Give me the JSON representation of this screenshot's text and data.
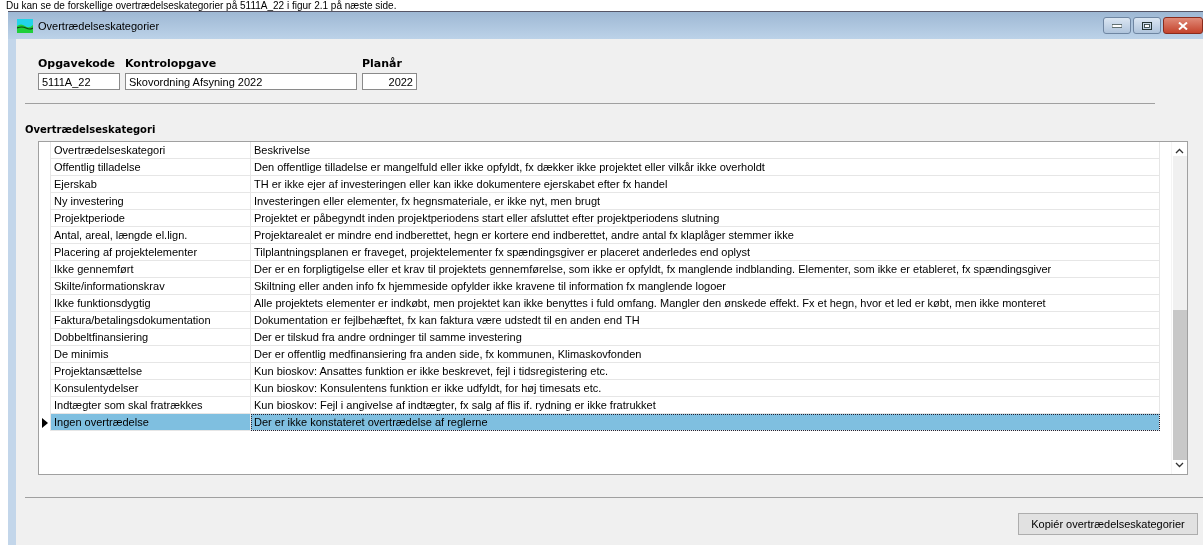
{
  "doc_text": "Du kan se de forskellige overtrædelseskategorier på 5111A_22 i figur 2.1 på næste side.",
  "window": {
    "title": "Overtrædelseskategorier"
  },
  "fields": [
    {
      "kind": "code",
      "label": "Opgavekode",
      "value": "5111A_22"
    },
    {
      "kind": "task",
      "label": "Kontrolopgave",
      "value": "Skovordning Afsyning 2022"
    },
    {
      "kind": "year",
      "label": "Planår",
      "value": "2022"
    }
  ],
  "section_label": "Overtrædelseskategori",
  "table": {
    "columns": [
      "Overtrædelseskategori",
      "Beskrivelse"
    ],
    "rows": [
      {
        "category": "Offentlig tilladelse",
        "description": "Den offentlige tilladelse er mangelfuld eller ikke opfyldt, fx dækker ikke projektet eller vilkår ikke overholdt",
        "selected": false
      },
      {
        "category": "Ejerskab",
        "description": "TH er ikke ejer af investeringen eller kan ikke dokumentere ejerskabet efter fx handel",
        "selected": false
      },
      {
        "category": "Ny investering",
        "description": "Investeringen eller elementer, fx hegnsmateriale, er ikke nyt, men brugt",
        "selected": false
      },
      {
        "category": "Projektperiode",
        "description": "Projektet er påbegyndt inden projektperiodens start eller afsluttet efter projektperiodens slutning",
        "selected": false
      },
      {
        "category": "Antal, areal, længde el.lign.",
        "description": "Projektarealet er mindre end indberettet, hegn er kortere end indberettet, andre antal fx klaplåger stemmer ikke",
        "selected": false
      },
      {
        "category": "Placering af projektelementer",
        "description": "Tilplantningsplanen er fraveget, projektelementer fx spændingsgiver er placeret anderledes end oplyst",
        "selected": false
      },
      {
        "category": "Ikke gennemført",
        "description": "Der er en forpligtigelse eller et krav til projektets gennemførelse, som ikke er opfyldt, fx manglende indblanding. Elementer, som ikke er etableret, fx spændingsgiver",
        "selected": false
      },
      {
        "category": "Skilte/informationskrav",
        "description": "Skiltning eller anden info fx hjemmeside opfylder ikke kravene til information fx manglende logoer",
        "selected": false
      },
      {
        "category": "Ikke funktionsdygtig",
        "description": "Alle projektets elementer er indkøbt, men projektet kan ikke benyttes i fuld omfang. Mangler den ønskede effekt. Fx et hegn, hvor et led er købt, men ikke monteret",
        "selected": false
      },
      {
        "category": "Faktura/betalingsdokumentation",
        "description": "Dokumentation er fejlbehæftet, fx kan faktura være udstedt til en anden end TH",
        "selected": false
      },
      {
        "category": "Dobbeltfinansiering",
        "description": "Der er tilskud fra andre ordninger til samme investering",
        "selected": false
      },
      {
        "category": "De minimis",
        "description": "Der er offentlig medfinansiering fra anden side, fx kommunen, Klimaskovfonden",
        "selected": false
      },
      {
        "category": "Projektansættelse",
        "description": "Kun bioskov: Ansattes funktion er ikke beskrevet, fejl i tidsregistering etc.",
        "selected": false
      },
      {
        "category": "Konsulentydelser",
        "description": "Kun bioskov: Konsulentens funktion er ikke udfyldt, for høj timesats etc.",
        "selected": false
      },
      {
        "category": "Indtægter som skal fratrækkes",
        "description": "Kun bioskov: Fejl i angivelse af indtægter, fx salg af flis if. rydning er ikke fratrukket",
        "selected": false
      },
      {
        "category": "Ingen overtrædelse",
        "description": "Der er ikke konstateret overtrædelse af reglerne",
        "selected": true
      }
    ]
  },
  "button": "Kopiér overtrædelseskategorier"
}
